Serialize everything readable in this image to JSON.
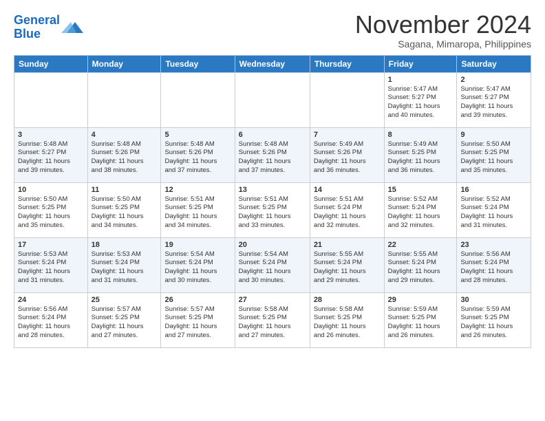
{
  "logo": {
    "line1": "General",
    "line2": "Blue"
  },
  "title": "November 2024",
  "subtitle": "Sagana, Mimaropa, Philippines",
  "weekdays": [
    "Sunday",
    "Monday",
    "Tuesday",
    "Wednesday",
    "Thursday",
    "Friday",
    "Saturday"
  ],
  "weeks": [
    [
      {
        "day": "",
        "info": ""
      },
      {
        "day": "",
        "info": ""
      },
      {
        "day": "",
        "info": ""
      },
      {
        "day": "",
        "info": ""
      },
      {
        "day": "",
        "info": ""
      },
      {
        "day": "1",
        "info": "Sunrise: 5:47 AM\nSunset: 5:27 PM\nDaylight: 11 hours\nand 40 minutes."
      },
      {
        "day": "2",
        "info": "Sunrise: 5:47 AM\nSunset: 5:27 PM\nDaylight: 11 hours\nand 39 minutes."
      }
    ],
    [
      {
        "day": "3",
        "info": "Sunrise: 5:48 AM\nSunset: 5:27 PM\nDaylight: 11 hours\nand 39 minutes."
      },
      {
        "day": "4",
        "info": "Sunrise: 5:48 AM\nSunset: 5:26 PM\nDaylight: 11 hours\nand 38 minutes."
      },
      {
        "day": "5",
        "info": "Sunrise: 5:48 AM\nSunset: 5:26 PM\nDaylight: 11 hours\nand 37 minutes."
      },
      {
        "day": "6",
        "info": "Sunrise: 5:48 AM\nSunset: 5:26 PM\nDaylight: 11 hours\nand 37 minutes."
      },
      {
        "day": "7",
        "info": "Sunrise: 5:49 AM\nSunset: 5:26 PM\nDaylight: 11 hours\nand 36 minutes."
      },
      {
        "day": "8",
        "info": "Sunrise: 5:49 AM\nSunset: 5:25 PM\nDaylight: 11 hours\nand 36 minutes."
      },
      {
        "day": "9",
        "info": "Sunrise: 5:50 AM\nSunset: 5:25 PM\nDaylight: 11 hours\nand 35 minutes."
      }
    ],
    [
      {
        "day": "10",
        "info": "Sunrise: 5:50 AM\nSunset: 5:25 PM\nDaylight: 11 hours\nand 35 minutes."
      },
      {
        "day": "11",
        "info": "Sunrise: 5:50 AM\nSunset: 5:25 PM\nDaylight: 11 hours\nand 34 minutes."
      },
      {
        "day": "12",
        "info": "Sunrise: 5:51 AM\nSunset: 5:25 PM\nDaylight: 11 hours\nand 34 minutes."
      },
      {
        "day": "13",
        "info": "Sunrise: 5:51 AM\nSunset: 5:25 PM\nDaylight: 11 hours\nand 33 minutes."
      },
      {
        "day": "14",
        "info": "Sunrise: 5:51 AM\nSunset: 5:24 PM\nDaylight: 11 hours\nand 32 minutes."
      },
      {
        "day": "15",
        "info": "Sunrise: 5:52 AM\nSunset: 5:24 PM\nDaylight: 11 hours\nand 32 minutes."
      },
      {
        "day": "16",
        "info": "Sunrise: 5:52 AM\nSunset: 5:24 PM\nDaylight: 11 hours\nand 31 minutes."
      }
    ],
    [
      {
        "day": "17",
        "info": "Sunrise: 5:53 AM\nSunset: 5:24 PM\nDaylight: 11 hours\nand 31 minutes."
      },
      {
        "day": "18",
        "info": "Sunrise: 5:53 AM\nSunset: 5:24 PM\nDaylight: 11 hours\nand 31 minutes."
      },
      {
        "day": "19",
        "info": "Sunrise: 5:54 AM\nSunset: 5:24 PM\nDaylight: 11 hours\nand 30 minutes."
      },
      {
        "day": "20",
        "info": "Sunrise: 5:54 AM\nSunset: 5:24 PM\nDaylight: 11 hours\nand 30 minutes."
      },
      {
        "day": "21",
        "info": "Sunrise: 5:55 AM\nSunset: 5:24 PM\nDaylight: 11 hours\nand 29 minutes."
      },
      {
        "day": "22",
        "info": "Sunrise: 5:55 AM\nSunset: 5:24 PM\nDaylight: 11 hours\nand 29 minutes."
      },
      {
        "day": "23",
        "info": "Sunrise: 5:56 AM\nSunset: 5:24 PM\nDaylight: 11 hours\nand 28 minutes."
      }
    ],
    [
      {
        "day": "24",
        "info": "Sunrise: 5:56 AM\nSunset: 5:24 PM\nDaylight: 11 hours\nand 28 minutes."
      },
      {
        "day": "25",
        "info": "Sunrise: 5:57 AM\nSunset: 5:25 PM\nDaylight: 11 hours\nand 27 minutes."
      },
      {
        "day": "26",
        "info": "Sunrise: 5:57 AM\nSunset: 5:25 PM\nDaylight: 11 hours\nand 27 minutes."
      },
      {
        "day": "27",
        "info": "Sunrise: 5:58 AM\nSunset: 5:25 PM\nDaylight: 11 hours\nand 27 minutes."
      },
      {
        "day": "28",
        "info": "Sunrise: 5:58 AM\nSunset: 5:25 PM\nDaylight: 11 hours\nand 26 minutes."
      },
      {
        "day": "29",
        "info": "Sunrise: 5:59 AM\nSunset: 5:25 PM\nDaylight: 11 hours\nand 26 minutes."
      },
      {
        "day": "30",
        "info": "Sunrise: 5:59 AM\nSunset: 5:25 PM\nDaylight: 11 hours\nand 26 minutes."
      }
    ]
  ]
}
